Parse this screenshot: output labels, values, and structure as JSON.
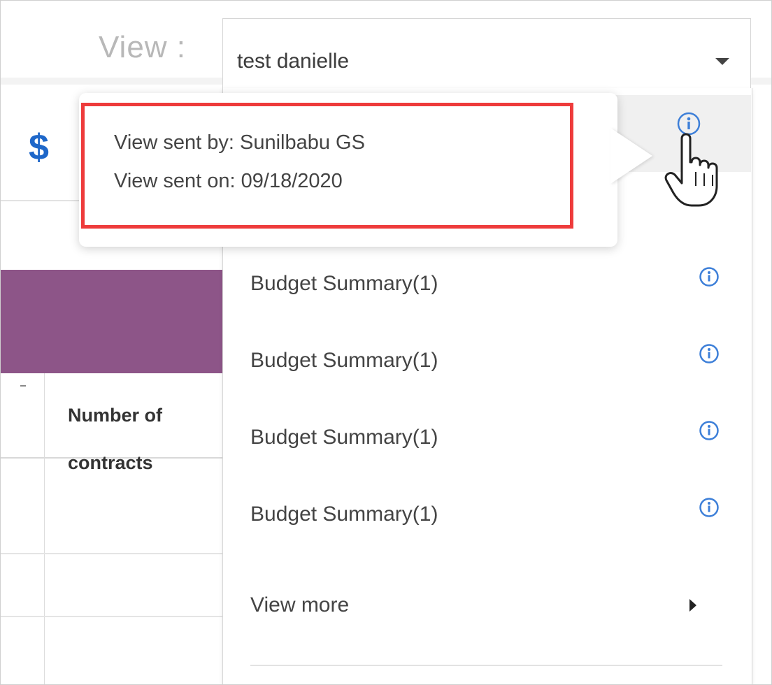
{
  "view_selector": {
    "label": "View :",
    "selected_value": "test danielle"
  },
  "background": {
    "currency_symbol": "$",
    "column_header_line1": "Number of",
    "column_header_line2": "contracts",
    "header_band_color": "#8d5588",
    "currency_color": "#1e67c9"
  },
  "tooltip": {
    "sent_by": "View sent by: Sunilbabu GS",
    "sent_on": "View sent on: 09/18/2020",
    "highlight_color": "#ee3b3b"
  },
  "menu": {
    "items": [
      {
        "label": "Budget Summary(1)"
      },
      {
        "label": "Budget Summary(1)"
      },
      {
        "label": "Budget Summary(1)"
      },
      {
        "label": "Budget Summary(1)"
      }
    ],
    "view_more_label": "View more",
    "info_icon_color": "#3d7fd8"
  }
}
